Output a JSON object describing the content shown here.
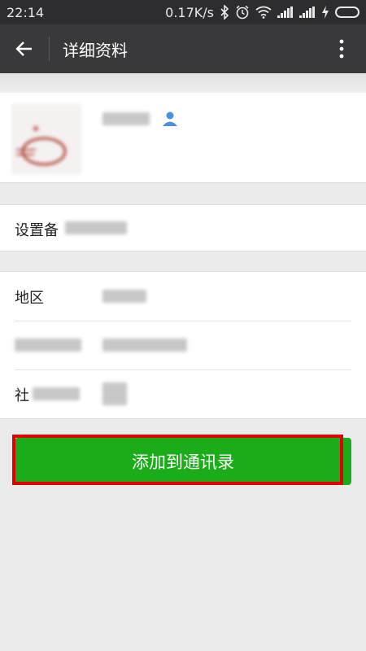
{
  "status_bar": {
    "time": "22:14",
    "net_speed": "0.17K/s",
    "icons": [
      "bluetooth-icon",
      "alarm-icon",
      "wifi-icon",
      "signal-icon",
      "signal-icon",
      "charging-icon",
      "battery-icon"
    ]
  },
  "app_bar": {
    "back_icon": "arrow-left-icon",
    "title": "详细资料",
    "more_icon": "more-vertical-icon"
  },
  "profile": {
    "nickname": "",
    "gender_icon": "user-icon"
  },
  "remark": {
    "label": "设置备"
  },
  "info_rows": [
    {
      "label": "地区",
      "value": ""
    },
    {
      "label": "",
      "value": ""
    },
    {
      "label": "社",
      "value": ""
    }
  ],
  "actions": {
    "add_contact_label": "添加到通讯录"
  },
  "colors": {
    "status_bar_bg": "#2d2d30",
    "app_bar_bg": "#39393b",
    "primary_button": "#1aad19",
    "highlight": "#e00000",
    "page_bg": "#ebebeb"
  }
}
